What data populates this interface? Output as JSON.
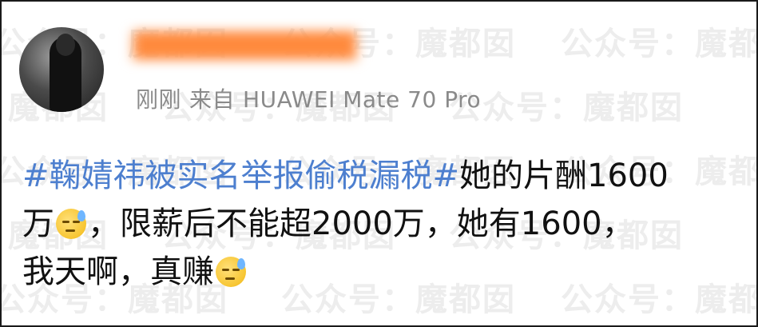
{
  "watermark": {
    "text_full": "公众号：魔都囡",
    "text_mid": "魔都囡",
    "text_right": "魔"
  },
  "post": {
    "meta": {
      "time": "刚刚",
      "source_prefix": "来自",
      "device": "HUAWEI Mate 70 Pro"
    },
    "hashtag": "#鞠婧祎被实名举报偷税漏税#",
    "line1_text": "她的片酬1600",
    "line2_a": "万",
    "line2_b": "，限薪后不能超2000万，她有1600，",
    "line3_a": "我天啊，真赚"
  },
  "icons": {
    "emoji": "sweat-smile-emoji",
    "avatar": "user-avatar"
  }
}
